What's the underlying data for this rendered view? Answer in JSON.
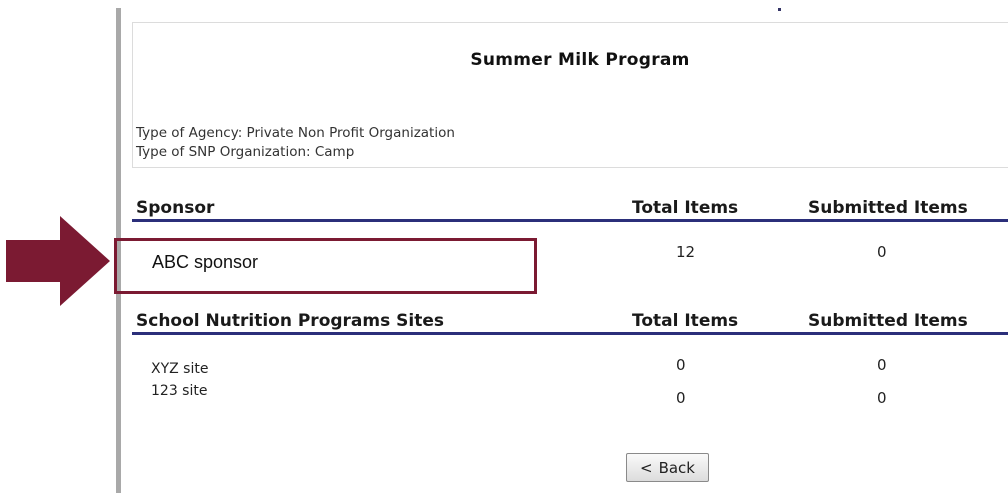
{
  "program": {
    "title": "Summer Milk Program",
    "agency_line": "Type of Agency: Private Non Profit Organization",
    "snp_line": "Type of SNP Organization: Camp"
  },
  "sponsor_section": {
    "header": "Sponsor",
    "total_header": "Total Items",
    "submitted_header": "Submitted Items",
    "rows": [
      {
        "name": "ABC sponsor",
        "total": "12",
        "submitted": "0"
      }
    ]
  },
  "sites_section": {
    "header": "School Nutrition Programs Sites",
    "total_header": "Total Items",
    "submitted_header": "Submitted Items",
    "rows": [
      {
        "name": "XYZ site",
        "total": "0",
        "submitted": "0"
      },
      {
        "name": "123 site",
        "total": "0",
        "submitted": "0"
      }
    ]
  },
  "back_button": {
    "label": "Back",
    "icon": "chevron-left-icon",
    "glyph": "<"
  },
  "annotation": {
    "color": "#7b1a32",
    "arrow_icon": "arrow-right-icon"
  },
  "colors": {
    "header_rule": "#2b2f7a"
  }
}
